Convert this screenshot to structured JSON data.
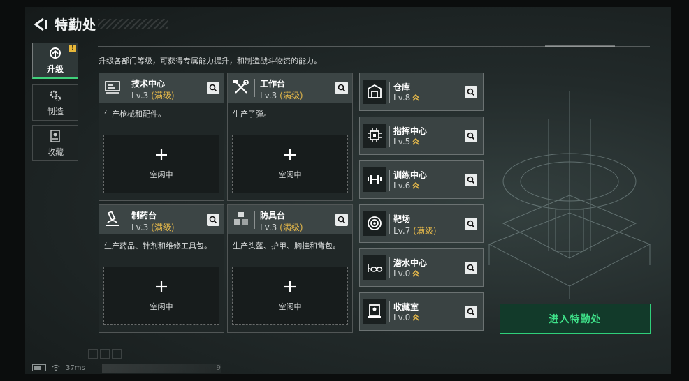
{
  "header": {
    "title": "特勤处",
    "back_icon": "back-arrow-icon"
  },
  "nav": [
    {
      "label": "升级",
      "icon": "upgrade-icon",
      "active": true,
      "badge": "!"
    },
    {
      "label": "制造",
      "icon": "gears-icon",
      "active": false
    },
    {
      "label": "收藏",
      "icon": "collection-icon",
      "active": false
    }
  ],
  "description": "升级各部门等级，可获得专属能力提升，和制造战斗物资的能力。",
  "facilities": [
    {
      "name": "技术中心",
      "level": "Lv.3",
      "status": "(满级)",
      "desc": "生产枪械和配件。",
      "slot_label": "空闲中",
      "icon": "monitor-icon"
    },
    {
      "name": "工作台",
      "level": "Lv.3",
      "status": "(满级)",
      "desc": "生产子弹。",
      "slot_label": "空闲中",
      "icon": "tools-icon"
    },
    {
      "name": "制药台",
      "level": "Lv.3",
      "status": "(满级)",
      "desc": "生产药品、针剂和维修工具包。",
      "slot_label": "空闲中",
      "icon": "microscope-icon"
    },
    {
      "name": "防具台",
      "level": "Lv.3",
      "status": "(满级)",
      "desc": "生产头盔、护甲、胸挂和背包。",
      "slot_label": "空闲中",
      "icon": "armor-icon"
    }
  ],
  "departments": [
    {
      "name": "仓库",
      "level": "Lv.8",
      "status": "",
      "icon": "warehouse-icon"
    },
    {
      "name": "指挥中心",
      "level": "Lv.5",
      "status": "",
      "icon": "chip-icon"
    },
    {
      "name": "训练中心",
      "level": "Lv.6",
      "status": "",
      "icon": "dumbbell-icon"
    },
    {
      "name": "靶场",
      "level": "Lv.7",
      "status": "(满级)",
      "icon": "target-icon"
    },
    {
      "name": "潜水中心",
      "level": "Lv.0",
      "status": "",
      "icon": "diving-goggles-icon"
    },
    {
      "name": "收藏室",
      "level": "Lv.0",
      "status": "",
      "icon": "display-case-icon"
    }
  ],
  "enter_button": "进入特勤处",
  "status_bar": {
    "ping": "37ms",
    "uid_tail": "9"
  },
  "colors": {
    "accent_green": "#3fe38a",
    "maxed_gold": "#e2b64a",
    "badge": "#e8b83a"
  }
}
